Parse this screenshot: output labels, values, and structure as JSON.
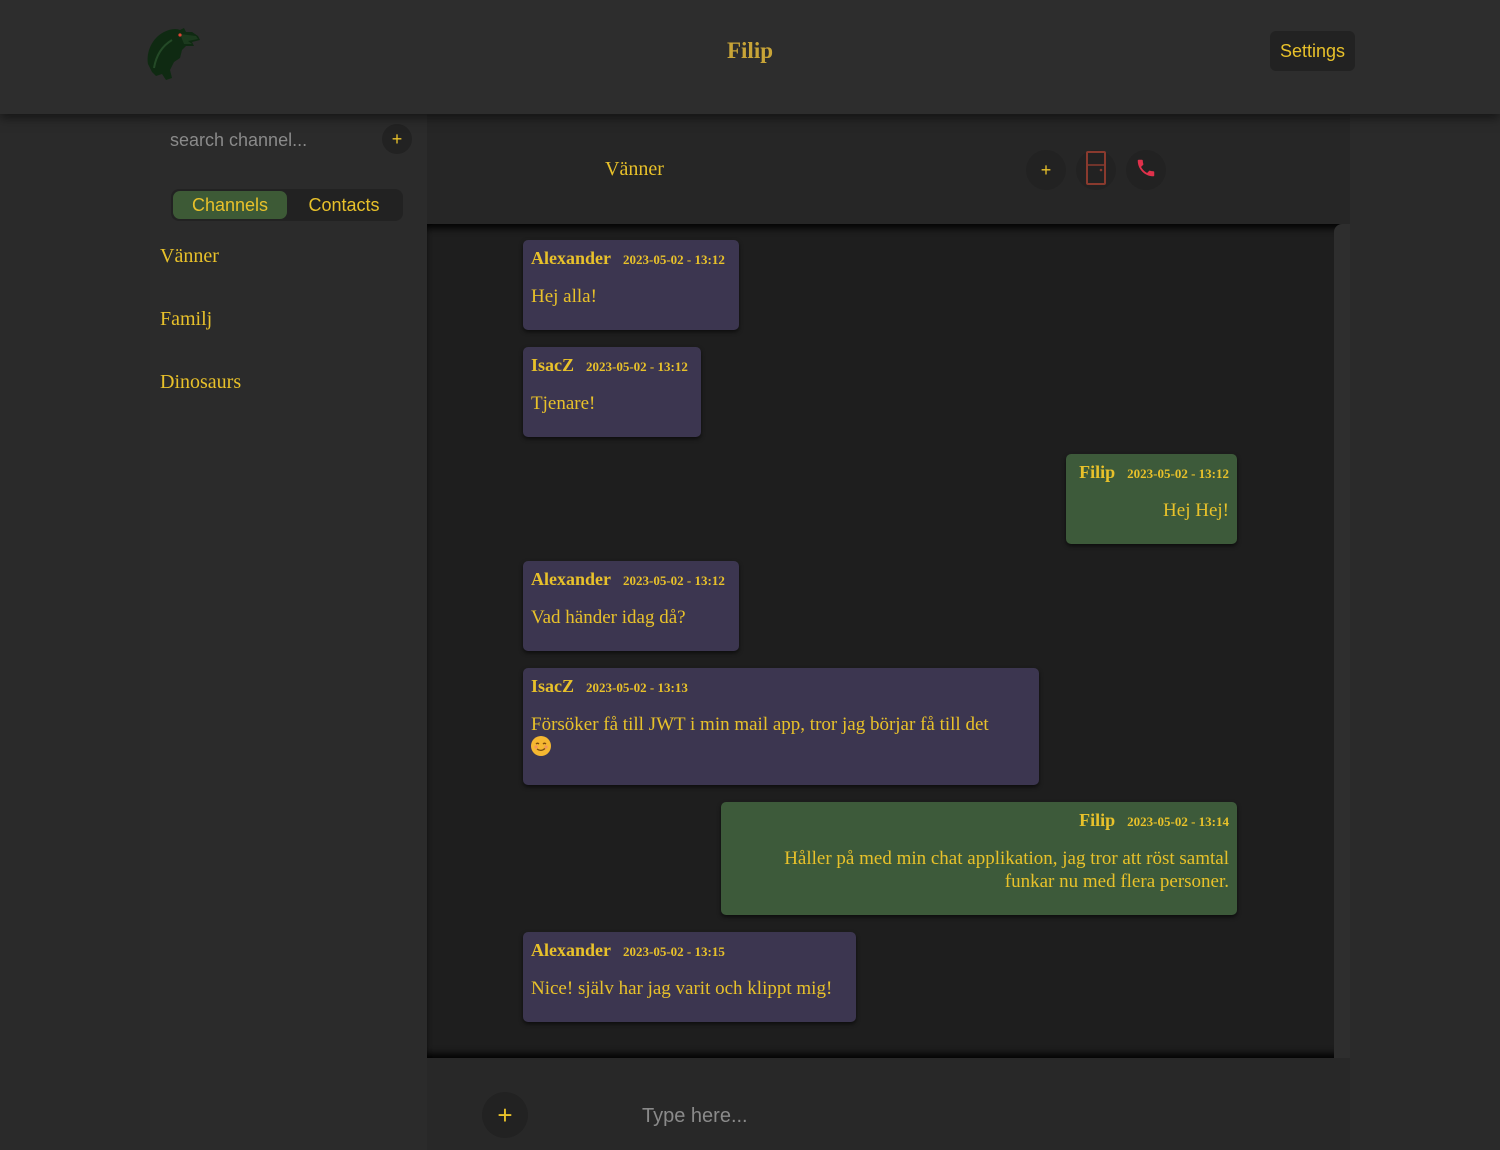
{
  "header": {
    "user_name": "Filip",
    "settings_label": "Settings"
  },
  "sidebar": {
    "search_placeholder": "search channel...",
    "add_label": "+",
    "tabs": [
      {
        "label": "Channels",
        "active": true
      },
      {
        "label": "Contacts",
        "active": false
      }
    ],
    "channels": [
      "Vänner",
      "Familj",
      "Dinosaurs"
    ]
  },
  "chat": {
    "title": "Vänner",
    "add_label": "+",
    "leave_icon": "door-icon",
    "call_icon": "phone-icon",
    "messages": [
      {
        "author": "Alexander",
        "time": "2023-05-02 - 13:12",
        "text": "Hej alla!",
        "mine": false
      },
      {
        "author": "IsacZ",
        "time": "2023-05-02 - 13:12",
        "text": "Tjenare!",
        "mine": false
      },
      {
        "author": "Filip",
        "time": "2023-05-02 - 13:12",
        "text": "Hej Hej!",
        "mine": true
      },
      {
        "author": "Alexander",
        "time": "2023-05-02 - 13:12",
        "text": "Vad händer idag då?",
        "mine": false
      },
      {
        "author": "IsacZ",
        "time": "2023-05-02 - 13:13",
        "text": "Försöker få till JWT i min mail app, tror jag börjar få till det",
        "emoji": "relieved-face",
        "mine": false
      },
      {
        "author": "Filip",
        "time": "2023-05-02 - 13:14",
        "text": "Håller på med min chat applikation, jag tror att röst samtal funkar nu med flera personer.",
        "mine": true
      },
      {
        "author": "Alexander",
        "time": "2023-05-02 - 13:15",
        "text": "Nice! själv har jag varit och klippt mig!",
        "mine": false
      }
    ]
  },
  "composer": {
    "attach_label": "+",
    "placeholder": "Type here..."
  },
  "colors": {
    "accent": "#e8c12a",
    "other_bubble": "#3c3650",
    "own_bubble": "#3d5a3a",
    "active_tab": "#3d5a36",
    "hangup": "#e0314b"
  }
}
